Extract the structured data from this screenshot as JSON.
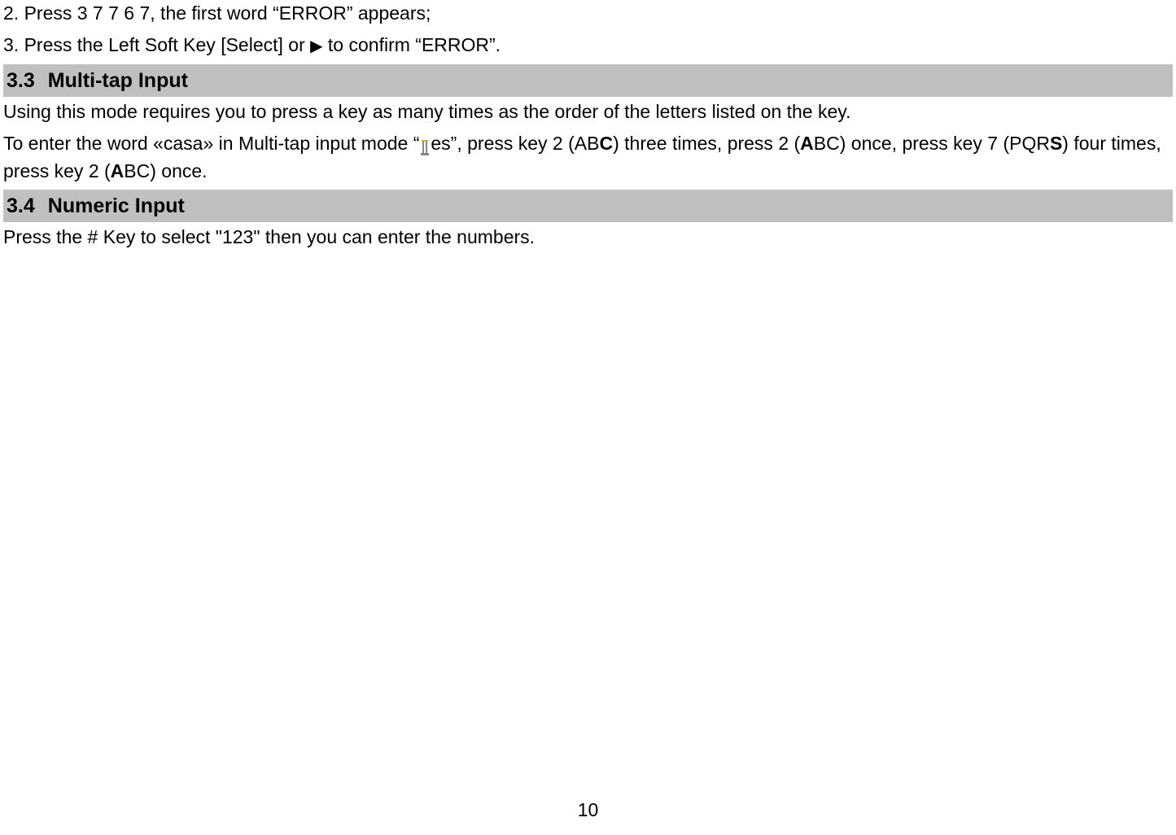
{
  "steps": {
    "s2": "2. Press 3 7 7 6 7, the first word “ERROR” appears;",
    "s3_a": "3. Press the Left Soft Key [Select] or ",
    "s3_arrow": "▶",
    "s3_b": " to confirm “ERROR”."
  },
  "section33": {
    "num": "3.3",
    "title": "Multi-tap Input",
    "p1": "Using this mode requires you to press a key as many times as the order of the letters listed on the key.",
    "p2_a": "To enter the word «casa» in Multi-tap input mode “",
    "p2_b": "es”, press key 2 (AB",
    "p2_c": "C",
    "p2_d": ") three times, press 2 (",
    "p2_e": "A",
    "p2_f": "BC) once, press key 7 (PQR",
    "p2_g": "S",
    "p2_h": ") four times, press key 2 (",
    "p2_i": "A",
    "p2_j": "BC) once."
  },
  "section34": {
    "num": "3.4",
    "title": "Numeric Input",
    "p1": "Press the # Key to select \"123\" then you can enter the numbers."
  },
  "pageNumber": "10"
}
